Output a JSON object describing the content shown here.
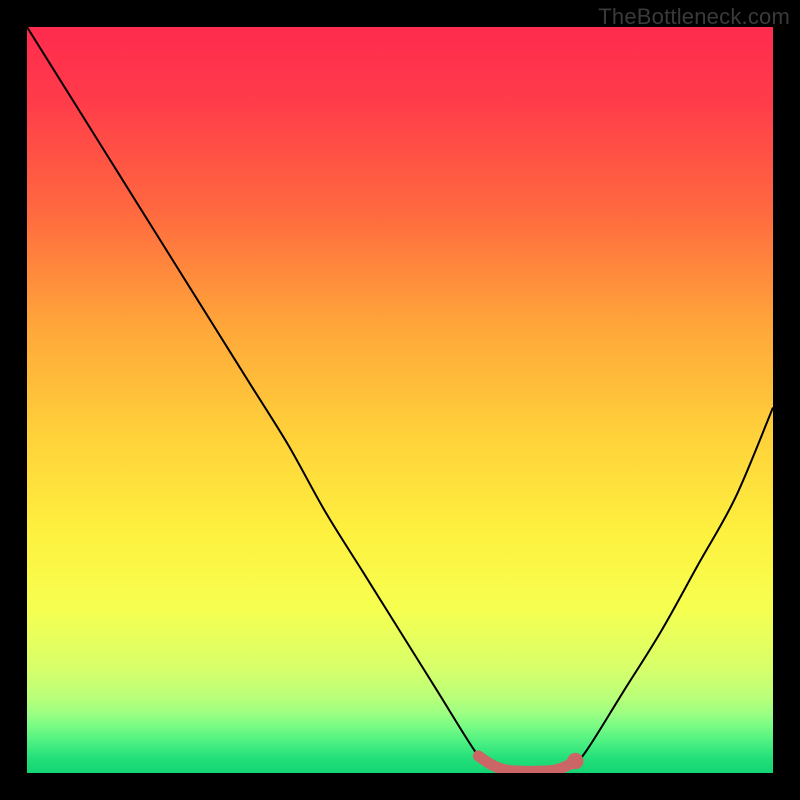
{
  "watermark": "TheBottleneck.com",
  "chart_data": {
    "type": "line",
    "title": "",
    "xlabel": "",
    "ylabel": "",
    "xlim": [
      0,
      100
    ],
    "ylim": [
      0,
      100
    ],
    "grid": false,
    "legend": false,
    "curve": {
      "name": "bottleneck-curve",
      "x": [
        0,
        5,
        10,
        15,
        20,
        25,
        30,
        35,
        40,
        45,
        50,
        55,
        60,
        62,
        65,
        70,
        73,
        75,
        80,
        85,
        90,
        95,
        100
      ],
      "y": [
        100,
        92,
        84,
        76,
        68,
        60,
        52,
        44,
        35,
        27,
        19,
        11,
        3,
        1,
        0,
        0,
        1,
        3,
        11,
        19,
        28,
        37,
        49
      ]
    },
    "highlight_segment": {
      "name": "optimal-range",
      "color": "#cc6666",
      "x": [
        60.5,
        62.5,
        65.0,
        70.0,
        72.0,
        73.5
      ],
      "y": [
        2.3,
        1.0,
        0.3,
        0.3,
        0.8,
        1.6
      ]
    },
    "highlight_endpoint": {
      "x": 73.5,
      "y": 1.6,
      "r": 1.1,
      "color": "#cc6666"
    },
    "gradient_stops": [
      {
        "offset": 0.0,
        "color": "#ff2b4e"
      },
      {
        "offset": 0.1,
        "color": "#ff3c4a"
      },
      {
        "offset": 0.25,
        "color": "#ff6a3f"
      },
      {
        "offset": 0.4,
        "color": "#ffa63a"
      },
      {
        "offset": 0.55,
        "color": "#ffd23a"
      },
      {
        "offset": 0.68,
        "color": "#fef13f"
      },
      {
        "offset": 0.78,
        "color": "#f6ff50"
      },
      {
        "offset": 0.86,
        "color": "#d7ff6a"
      },
      {
        "offset": 0.9,
        "color": "#b8ff7a"
      },
      {
        "offset": 0.92,
        "color": "#9cff82"
      },
      {
        "offset": 0.935,
        "color": "#7dfc84"
      },
      {
        "offset": 0.95,
        "color": "#5ef583"
      },
      {
        "offset": 0.965,
        "color": "#3fec80"
      },
      {
        "offset": 0.98,
        "color": "#24df79"
      },
      {
        "offset": 1.0,
        "color": "#12d573"
      }
    ]
  }
}
